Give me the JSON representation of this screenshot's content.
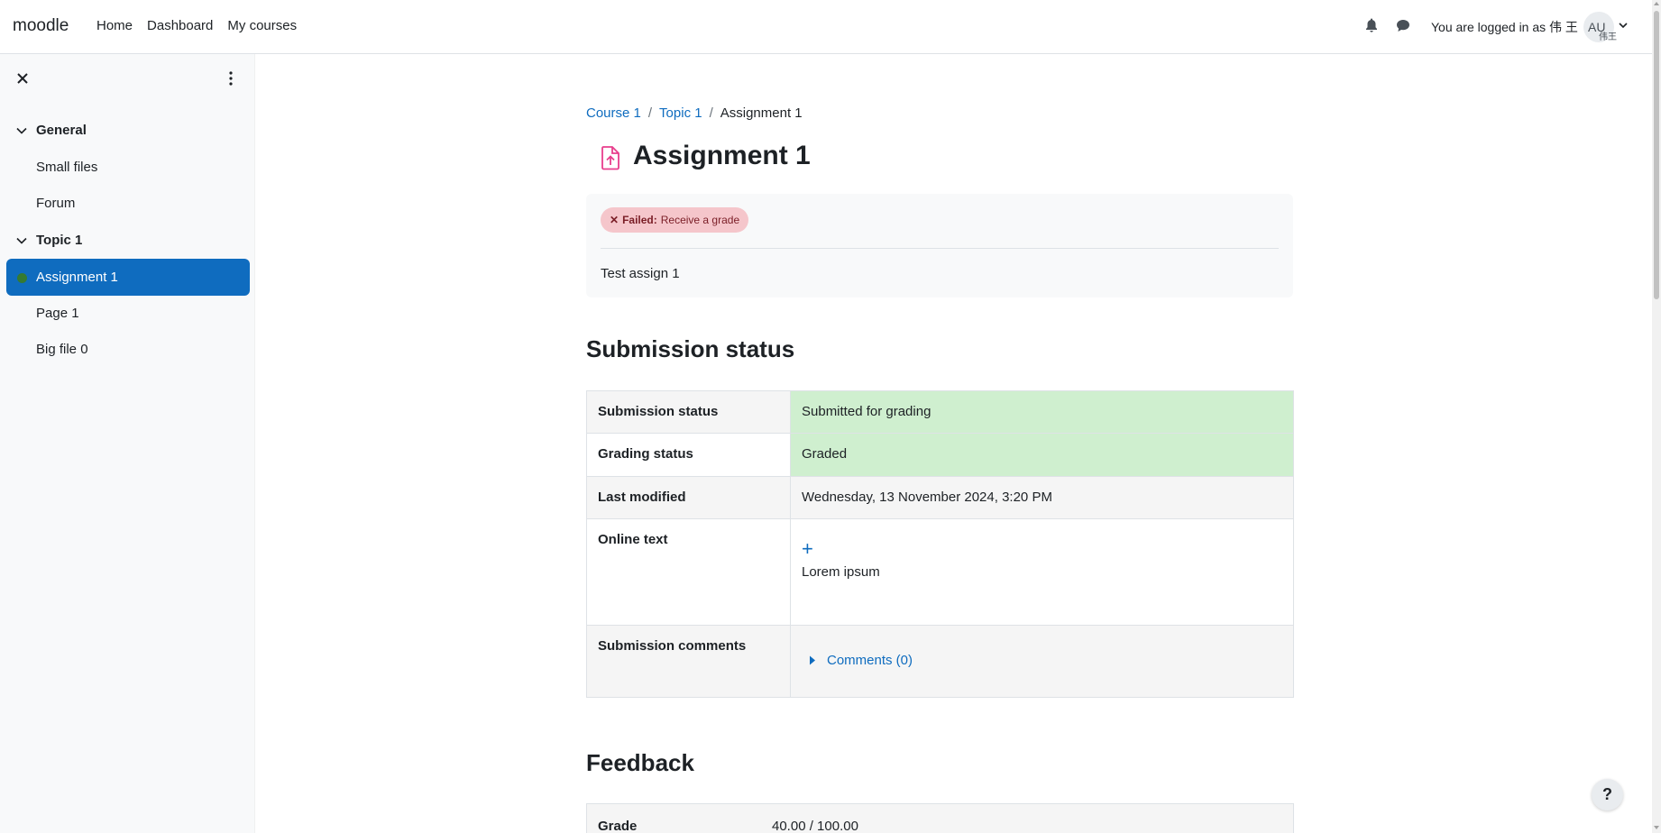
{
  "navbar": {
    "brand": "moodle",
    "links": [
      "Home",
      "Dashboard",
      "My courses"
    ],
    "login_text": "You are logged in as 伟 王",
    "avatar_initials": "AU",
    "avatar_sub": "伟王",
    "icons": [
      "bell-icon",
      "chat-icon",
      "chevron-down-icon"
    ]
  },
  "drawer": {
    "sections": [
      {
        "title": "General",
        "items": [
          "Small files",
          "Forum"
        ]
      },
      {
        "title": "Topic 1",
        "items": [
          "Assignment 1",
          "Page 1",
          "Big file 0"
        ]
      }
    ],
    "active_item": "Assignment 1"
  },
  "breadcrumb": {
    "items": [
      "Course 1",
      "Topic 1"
    ],
    "current": "Assignment 1"
  },
  "page": {
    "title": "Assignment 1",
    "badge_label": "Failed:",
    "badge_text": "Receive a grade",
    "description": "Test assign 1"
  },
  "submission": {
    "heading": "Submission status",
    "rows": [
      {
        "label": "Submission status",
        "value": "Submitted for grading"
      },
      {
        "label": "Grading status",
        "value": "Graded"
      },
      {
        "label": "Last modified",
        "value": "Wednesday, 13 November 2024, 3:20 PM"
      },
      {
        "label": "Online text",
        "value": "Lorem ipsum"
      },
      {
        "label": "Submission comments",
        "value": "Comments (0)"
      }
    ]
  },
  "feedback": {
    "heading": "Feedback",
    "grade_label": "Grade",
    "grade_value": "40.00 / 100.00"
  },
  "help": "?",
  "colors": {
    "accent": "#0f6cbf",
    "success_bg": "#cfefcf",
    "fail_badge": "#f5c6cb",
    "assign_icon": "#e83e8c"
  }
}
